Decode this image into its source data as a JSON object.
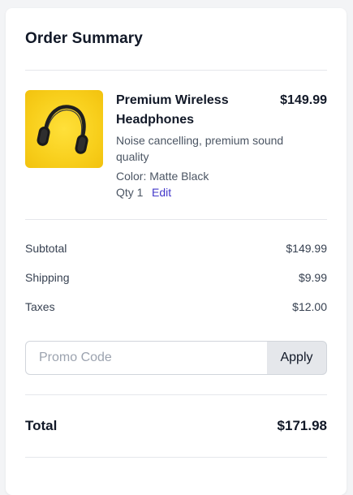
{
  "summary": {
    "title": "Order Summary"
  },
  "item": {
    "image_icon": "headphones-icon",
    "name": "Premium Wireless Headphones",
    "price": "$149.99",
    "description": "Noise cancelling, premium sound quality",
    "color": "Color: Matte Black",
    "quantity": "Qty 1",
    "edit_label": "Edit"
  },
  "totals": {
    "subtotal_label": "Subtotal",
    "subtotal_value": "$149.99",
    "shipping_label": "Shipping",
    "shipping_value": "$9.99",
    "taxes_label": "Taxes",
    "taxes_value": "$12.00",
    "total_label": "Total",
    "total_value": "$171.98"
  },
  "promo": {
    "placeholder": "Promo Code",
    "value": "",
    "apply_label": "Apply"
  },
  "colors": {
    "accent": "#4338ca",
    "image_background": "#f8cf1c",
    "apply_button_bg": "#e5e7eb"
  }
}
